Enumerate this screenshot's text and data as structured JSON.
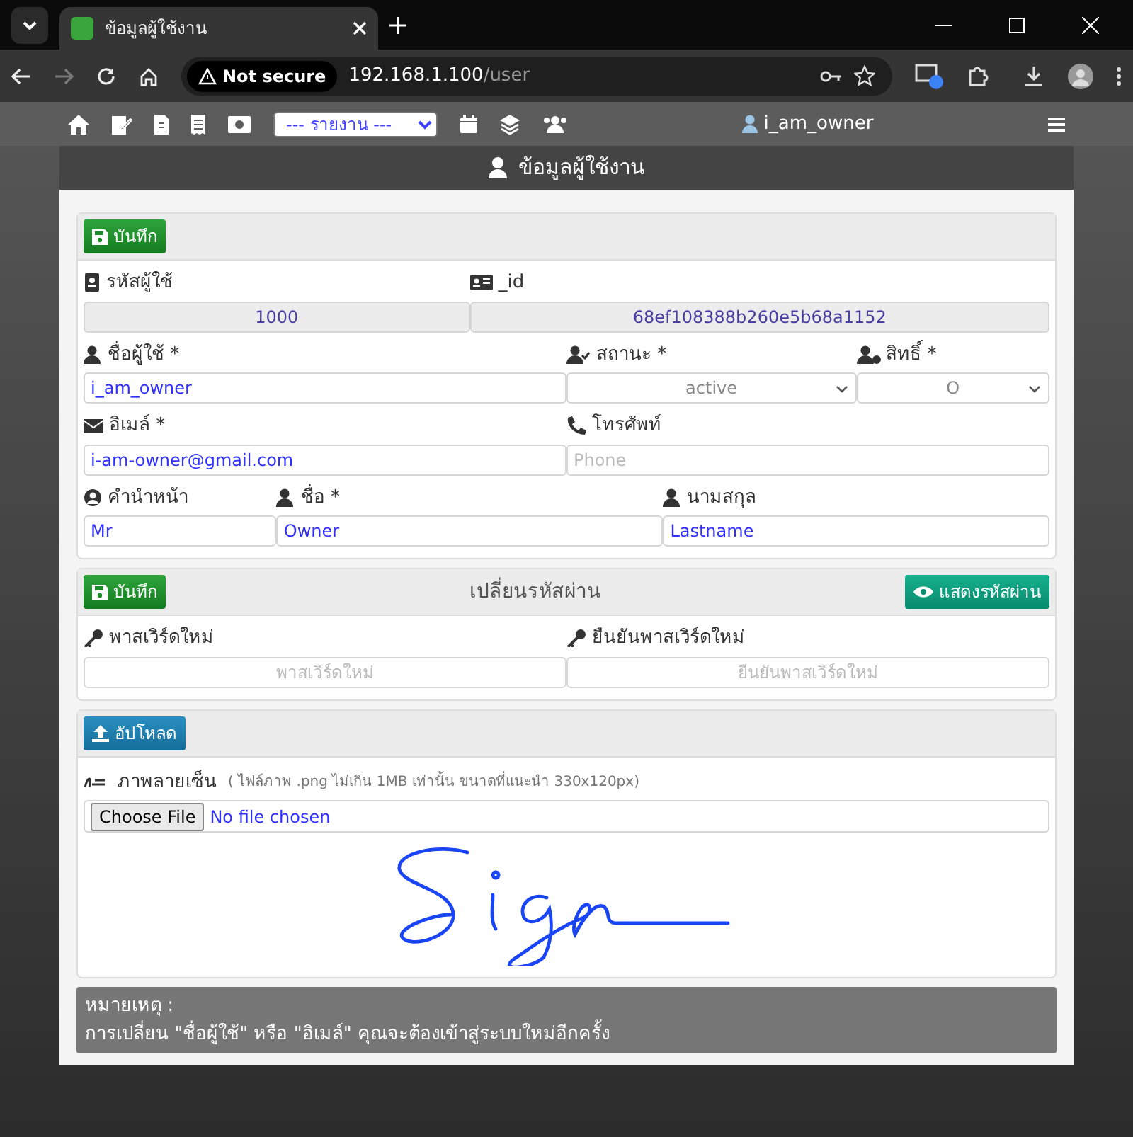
{
  "browser": {
    "tab_title": "ข้อมูลผู้ใช้งาน",
    "security": "Not secure",
    "url_host": "192.168.1.100",
    "url_path": "/user"
  },
  "toolbar": {
    "report_select": "--- รายงาน ---",
    "user": "i_am_owner"
  },
  "page_title": "ข้อมูลผู้ใช้งาน",
  "profile": {
    "save_button": "บันทึก",
    "field_groups": [
      {
        "fields": [
          {
            "label": "รหัสผู้ใช้",
            "kind": "readonly",
            "value": "1000"
          },
          {
            "label": "_id",
            "kind": "readonly",
            "value": "68ef108388b260e5b68a1152"
          }
        ]
      },
      {
        "fields": [
          {
            "label": "ชื่อผู้ใช้ *",
            "kind": "input",
            "value": "i_am_owner"
          },
          {
            "label": "สถานะ *",
            "kind": "select",
            "value": "active"
          },
          {
            "label": "สิทธิ์ *",
            "kind": "select",
            "value": "O"
          }
        ]
      },
      {
        "fields": [
          {
            "label": "อิเมล์ *",
            "kind": "input",
            "value": "i-am-owner@gmail.com"
          },
          {
            "label": "โทรศัพท์",
            "kind": "input",
            "placeholder": "Phone"
          }
        ]
      },
      {
        "fields": [
          {
            "label": "คำนำหน้า",
            "kind": "input",
            "value": "Mr"
          },
          {
            "label": "ชื่อ *",
            "kind": "input",
            "value": "Owner"
          },
          {
            "label": "นามสกุล",
            "kind": "input",
            "value": "Lastname"
          }
        ]
      }
    ]
  },
  "password": {
    "save_button": "บันทึก",
    "title": "เปลี่ยนรหัสผ่าน",
    "show_button": "แสดงรหัสผ่าน",
    "fields": [
      {
        "label": "พาสเวิร์ดใหม่",
        "placeholder": "พาสเวิร์ดใหม่"
      },
      {
        "label": "ยืนยันพาสเวิร์ดใหม่",
        "placeholder": "ยืนยันพาสเวิร์ดใหม่"
      }
    ]
  },
  "signature": {
    "upload_button": "อัปโหลด",
    "label": "ภาพลายเซ็น",
    "hint": "( ไฟล์ภาพ .png ไม่เกิน 1MB เท่านั้น ขนาดที่แนะนำ 330x120px)",
    "file_button": "Choose File",
    "file_status": "No file chosen"
  },
  "note": {
    "title": "หมายเหตุ :",
    "text": "การเปลี่ยน \"ชื่อผู้ใช้\" หรือ \"อิเมล์\" คุณจะต้องเข้าสู่ระบบใหม่อีกครั้ง"
  }
}
